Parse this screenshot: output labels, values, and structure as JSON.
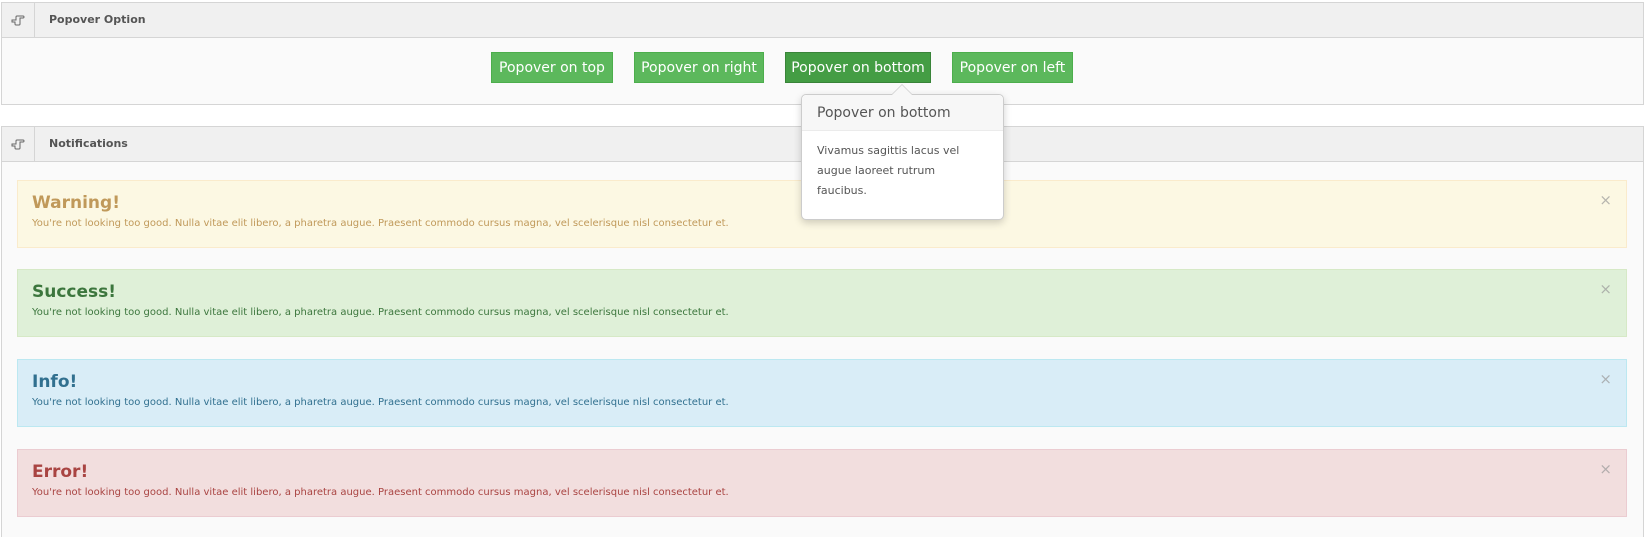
{
  "panels": {
    "popover": {
      "title": "Popover Option",
      "icon": "hand-pointer-icon"
    },
    "notifications": {
      "title": "Notifications",
      "icon": "hand-pointer-icon"
    }
  },
  "buttons": {
    "top": "Popover on top",
    "right": "Popover on right",
    "bottom": "Popover on bottom",
    "left": "Popover on left"
  },
  "popover": {
    "title": "Popover on bottom",
    "content": "Vivamus sagittis lacus vel augue laoreet rutrum faucibus."
  },
  "alerts": {
    "warning": {
      "title": "Warning!",
      "text": "You're not looking too good. Nulla vitae elit libero, a pharetra augue. Praesent commodo cursus magna, vel scelerisque nisl consectetur et.",
      "close": "×"
    },
    "success": {
      "title": "Success!",
      "text": "You're not looking too good. Nulla vitae elit libero, a pharetra augue. Praesent commodo cursus magna, vel scelerisque nisl consectetur et.",
      "close": "×"
    },
    "info": {
      "title": "Info!",
      "text": "You're not looking too good. Nulla vitae elit libero, a pharetra augue. Praesent commodo cursus magna, vel scelerisque nisl consectetur et.",
      "close": "×"
    },
    "error": {
      "title": "Error!",
      "text": "You're not looking too good. Nulla vitae elit libero, a pharetra augue. Praesent commodo cursus magna, vel scelerisque nisl consectetur et.",
      "close": "×"
    }
  },
  "colors": {
    "button": "#5cb85c",
    "button_active": "#449d44",
    "warning": "#fcf8e3",
    "success": "#dff0d8",
    "info": "#d9edf7",
    "error": "#f2dede"
  }
}
